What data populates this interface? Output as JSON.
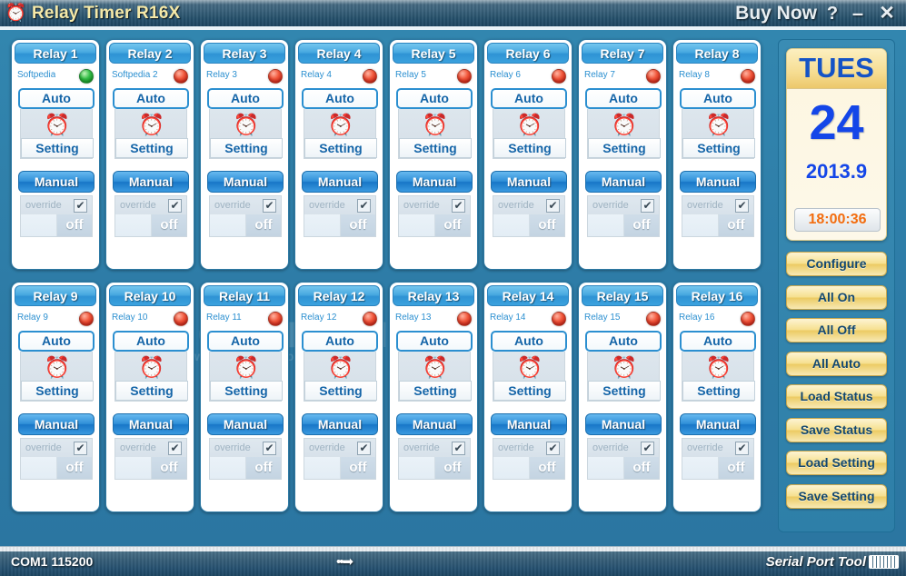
{
  "window": {
    "title": "Relay Timer R16X",
    "icon": "alarm-clock-icon",
    "buy_now": "Buy Now",
    "help": "?",
    "minimize": "–",
    "close": "✕"
  },
  "datecard": {
    "day_of_week": "TUES",
    "day": "24",
    "year_month": "2013.9",
    "time": "18:00:36"
  },
  "sidebar": {
    "buttons": [
      {
        "label": "Configure"
      },
      {
        "label": "All On"
      },
      {
        "label": "All Off"
      },
      {
        "label": "All Auto"
      },
      {
        "label": "Load Status"
      },
      {
        "label": "Save Status"
      },
      {
        "label": "Load Setting"
      },
      {
        "label": "Save Setting"
      }
    ]
  },
  "relay_common": {
    "auto_label": "Auto",
    "setting_label": "Setting",
    "manual_label": "Manual",
    "override_label": "override",
    "override_checked": "✔",
    "state_label": "off",
    "clock_icon": "⏰"
  },
  "relays": [
    {
      "title": "Relay 1",
      "name": "Softpedia",
      "led": "green",
      "auto": "Auto",
      "setting": "Setting",
      "manual": "Manual",
      "override": "override",
      "state": "off"
    },
    {
      "title": "Relay 2",
      "name": "Softpedia 2",
      "led": "red",
      "auto": "Auto",
      "setting": "Setting",
      "manual": "Manual",
      "override": "override",
      "state": "off"
    },
    {
      "title": "Relay 3",
      "name": "Relay 3",
      "led": "red",
      "auto": "Auto",
      "setting": "Setting",
      "manual": "Manual",
      "override": "override",
      "state": "off"
    },
    {
      "title": "Relay 4",
      "name": "Relay 4",
      "led": "red",
      "auto": "Auto",
      "setting": "Setting",
      "manual": "Manual",
      "override": "override",
      "state": "off"
    },
    {
      "title": "Relay 5",
      "name": "Relay 5",
      "led": "red",
      "auto": "Auto",
      "setting": "Setting",
      "manual": "Manual",
      "override": "override",
      "state": "off"
    },
    {
      "title": "Relay 6",
      "name": "Relay 6",
      "led": "red",
      "auto": "Auto",
      "setting": "Setting",
      "manual": "Manual",
      "override": "override",
      "state": "off"
    },
    {
      "title": "Relay 7",
      "name": "Relay 7",
      "led": "red",
      "auto": "Auto",
      "setting": "Setting",
      "manual": "Manual",
      "override": "override",
      "state": "off"
    },
    {
      "title": "Relay 8",
      "name": "Relay 8",
      "led": "red",
      "auto": "Auto",
      "setting": "Setting",
      "manual": "Manual",
      "override": "override",
      "state": "off"
    },
    {
      "title": "Relay 9",
      "name": "Relay 9",
      "led": "red",
      "auto": "Auto",
      "setting": "Setting",
      "manual": "Manual",
      "override": "override",
      "state": "off"
    },
    {
      "title": "Relay 10",
      "name": "Relay 10",
      "led": "red",
      "auto": "Auto",
      "setting": "Setting",
      "manual": "Manual",
      "override": "override",
      "state": "off"
    },
    {
      "title": "Relay 11",
      "name": "Relay 11",
      "led": "red",
      "auto": "Auto",
      "setting": "Setting",
      "manual": "Manual",
      "override": "override",
      "state": "off"
    },
    {
      "title": "Relay 12",
      "name": "Relay 12",
      "led": "red",
      "auto": "Auto",
      "setting": "Setting",
      "manual": "Manual",
      "override": "override",
      "state": "off"
    },
    {
      "title": "Relay 13",
      "name": "Relay 13",
      "led": "red",
      "auto": "Auto",
      "setting": "Setting",
      "manual": "Manual",
      "override": "override",
      "state": "off"
    },
    {
      "title": "Relay 14",
      "name": "Relay 14",
      "led": "red",
      "auto": "Auto",
      "setting": "Setting",
      "manual": "Manual",
      "override": "override",
      "state": "off"
    },
    {
      "title": "Relay 15",
      "name": "Relay 15",
      "led": "red",
      "auto": "Auto",
      "setting": "Setting",
      "manual": "Manual",
      "override": "override",
      "state": "off"
    },
    {
      "title": "Relay 16",
      "name": "Relay 16",
      "led": "red",
      "auto": "Auto",
      "setting": "Setting",
      "manual": "Manual",
      "override": "override",
      "state": "off"
    }
  ],
  "statusbar": {
    "port": "COM1 115200",
    "tx_indicator": "••➡",
    "brand": "Serial Port Tool"
  },
  "watermark": {
    "line1": "SOFTPEDIA",
    "line2": "www.softpedia.com"
  },
  "colors": {
    "accent_blue": "#2b8fd0",
    "panel_bg": "#2d7ba6",
    "title_gold": "#f5e9a8",
    "sidebar_button": "#f6e08f",
    "led_on": "#35bf48",
    "led_off": "#f2563a",
    "time_orange": "#f36d10",
    "date_blue": "#1446e8"
  }
}
